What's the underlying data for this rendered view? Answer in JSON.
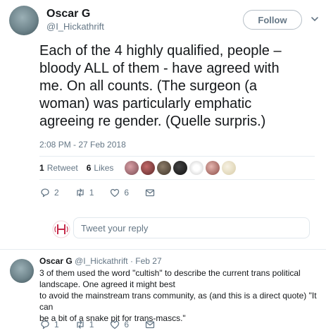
{
  "tweet": {
    "author_name": "Oscar G",
    "author_handle": "@I_Hickathrift",
    "follow_label": "Follow",
    "text": "Each of the 4 highly qualified, people –\nbloody ALL of them - have agreed with\nme. On all counts.  (The surgeon (a\nwoman) was particularly emphatic\nagreeing re gender. (Quelle surpris.)",
    "timestamp": "2:08 PM - 27 Feb 2018",
    "retweets_count": "1",
    "retweets_label": "Retweet",
    "likes_count": "6",
    "likes_label": "Likes",
    "reply_count": "2",
    "retweet_action_count": "1",
    "like_action_count": "6"
  },
  "reply_box": {
    "placeholder": "Tweet your reply"
  },
  "reply_tweet": {
    "author_name": "Oscar G",
    "author_handle": "@I_Hickathrift",
    "date": "· Feb 27",
    "text": "3 of them used the word \"cultish\" to describe the current trans political\nlandscape. One agreed it might best\nto avoid the mainstream trans community, as (and this is a direct quote) \"It can\nbe a bit of a snake pit for trans-mascs.\"",
    "reply_count": "1",
    "retweet_count": "1",
    "like_count": "6"
  },
  "colors": {
    "text_primary": "#14171a",
    "text_secondary": "#657786",
    "divider": "#e6ecf0",
    "brand_logo": "#c62a4a"
  }
}
